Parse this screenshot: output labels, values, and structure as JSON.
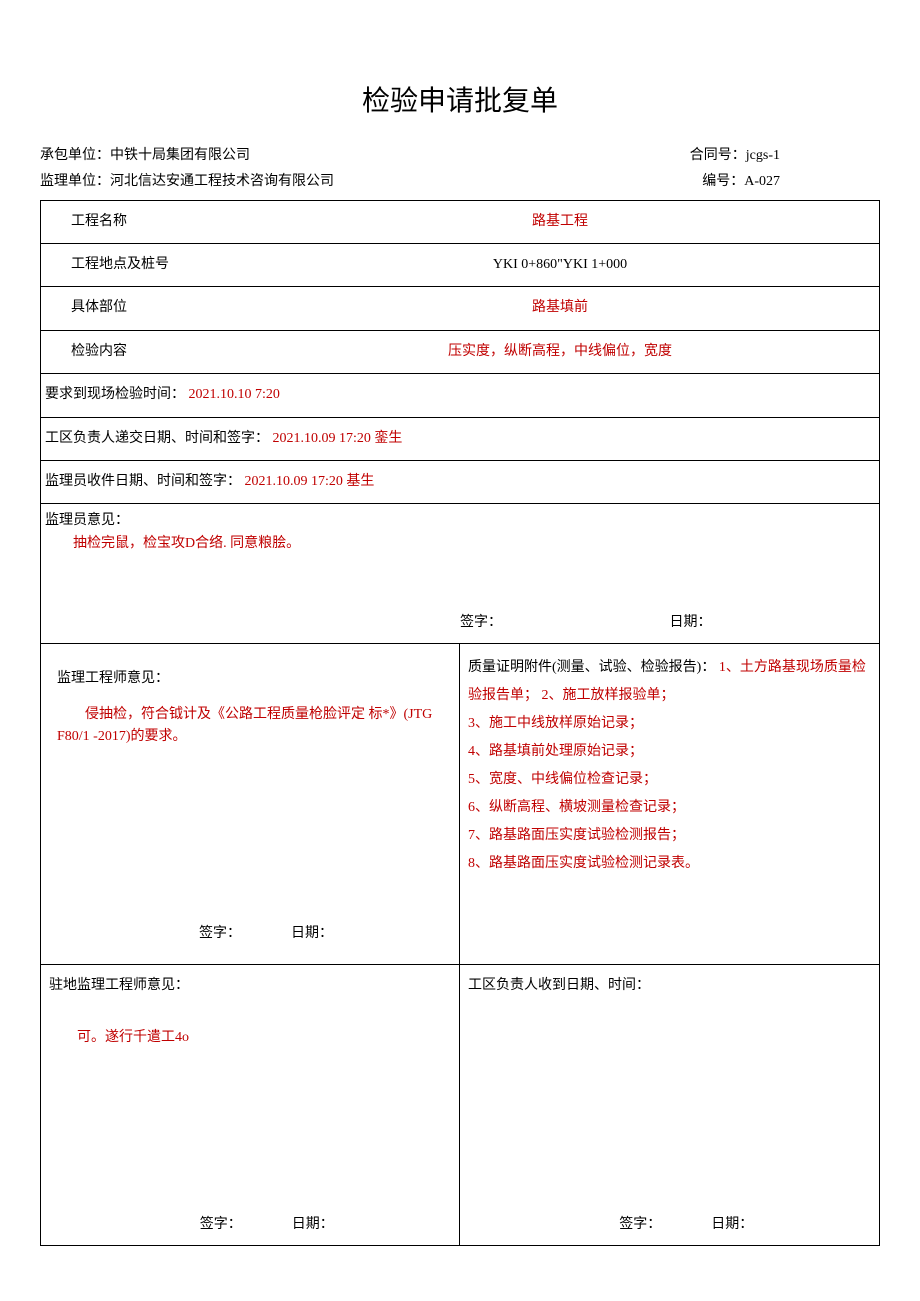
{
  "title": "检验申请批复单",
  "header": {
    "contractor_label": "承包单位：",
    "contractor_value": "中铁十局集团有限公司",
    "contract_no_label": "合同号：",
    "contract_no_value": "jcgs-1",
    "supervisor_label": "监理单位：",
    "supervisor_value": "河北信达安通工程技术咨询有限公司",
    "doc_no_label": "编号：",
    "doc_no_value": "A-027"
  },
  "rows": {
    "project_name_label": "工程名称",
    "project_name_value": "路基工程",
    "location_label": "工程地点及桩号",
    "location_value": "YKI 0+860\"YKI 1+000",
    "specific_part_label": "具体部位",
    "specific_part_value": "路基填前",
    "inspection_content_label": "检验内容",
    "inspection_content_value": "压实度，纵断高程，中线偏位，宽度",
    "required_time_label": "要求到现场检验时间：",
    "required_time_value": "2021.10.10 7:20",
    "submit_label": "工区负责人递交日期、时间和签字：",
    "submit_value": "2021.10.09 17:20 銮生",
    "receive_label": "监理员收件日期、时间和签字：",
    "receive_value": "2021.10.09 17:20 基生"
  },
  "supervisor_opinion": {
    "label": "监理员意见：",
    "content": "抽检完鼠，检宝攻D合络. 同意粮脍。",
    "sign_label": "签字：",
    "date_label": "日期："
  },
  "engineer_opinion": {
    "label": "监理工程师意见：",
    "content": "侵抽检，符合钺计及《公路工程质量枪脸评定 标*》(JTG F80/1 -2017)的要求。",
    "sign_label": "签字：",
    "date_label": "日期："
  },
  "attachments": {
    "label": "质量证明附件(测量、试验、检验报告)：",
    "items_inline": "1、土方路基现场质量检验报告单； 2、施工放样报验单；",
    "items": [
      "3、施工中线放样原始记录；",
      "4、路基填前处理原始记录；",
      "5、宽度、中线偏位检查记录；",
      "6、纵断高程、横坡测量检查记录；",
      "7、路基路面压实度试验检测报告；",
      "8、路基路面压实度试验检测记录表。"
    ]
  },
  "resident_engineer": {
    "label": "驻地监理工程师意见：",
    "content": "可。遂行千遣工4o",
    "sign_label": "签字：",
    "date_label": "日期："
  },
  "zone_receive": {
    "label": "工区负责人收到日期、时间：",
    "sign_label": "签字：",
    "date_label": "日期："
  }
}
